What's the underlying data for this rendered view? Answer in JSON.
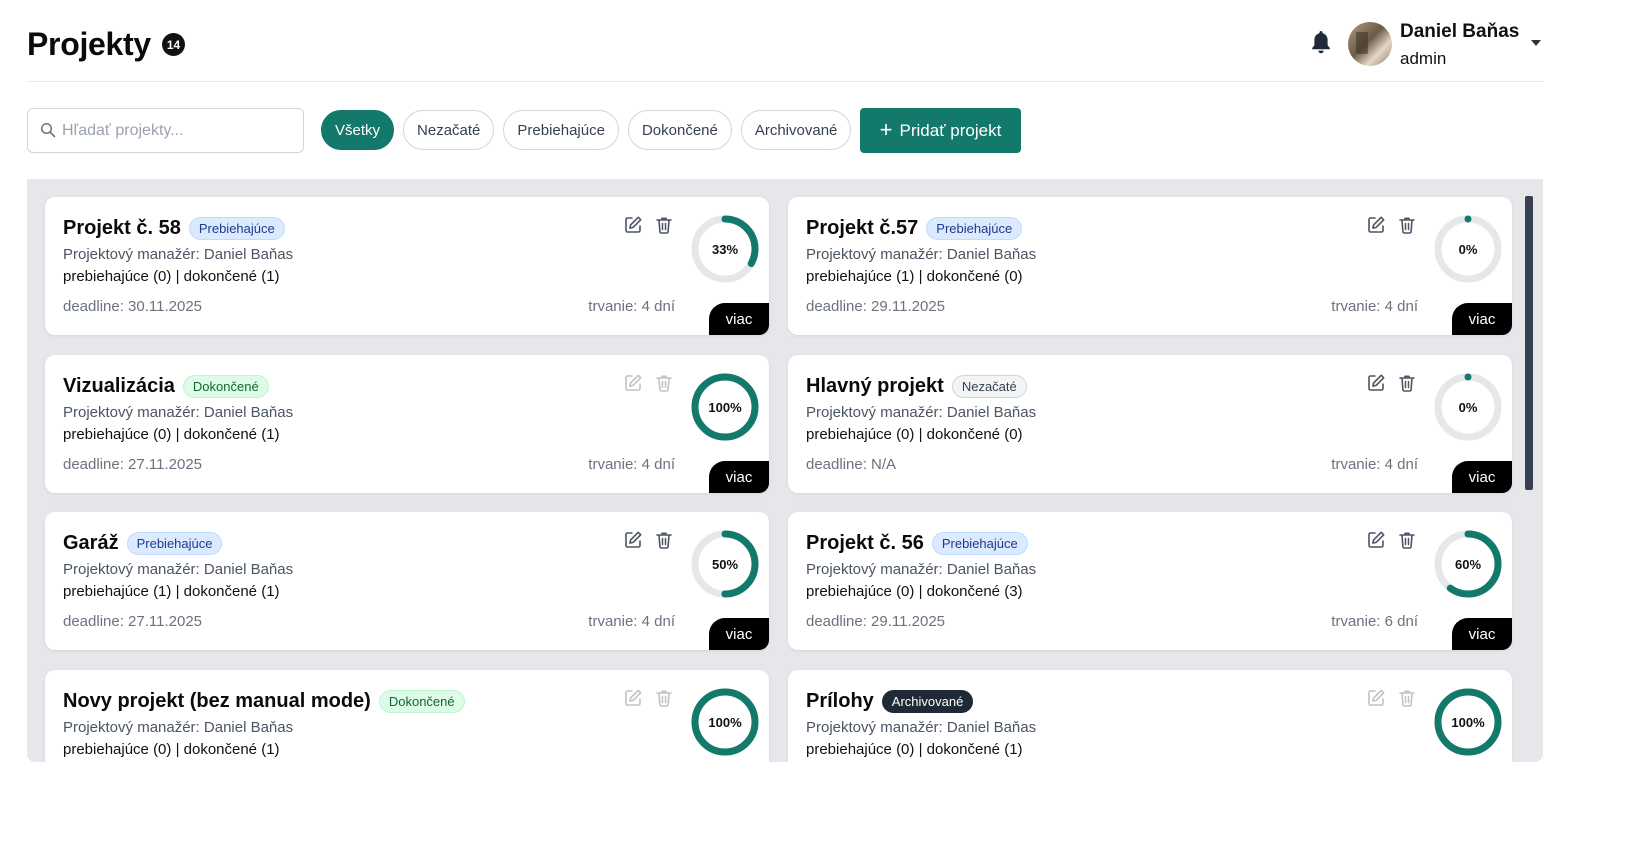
{
  "header": {
    "title": "Projekty",
    "count": "14",
    "user_name": "Daniel Baňas",
    "user_role": "admin"
  },
  "toolbar": {
    "search_placeholder": "Hľadať projekty...",
    "filters": [
      "Všetky",
      "Nezačaté",
      "Prebiehajúce",
      "Dokončené",
      "Archivované"
    ],
    "active_filter": "Všetky",
    "add_label": "Pridať projekt"
  },
  "colors": {
    "accent": "#12796b",
    "ring_track": "#e5e7eb"
  },
  "projects": [
    {
      "title": "Projekt č. 58",
      "status": "Prebiehajúce",
      "status_class": "prebiehajuce",
      "manager": "Projektový manažér: Daniel Baňas",
      "counts": "prebiehajúce (0) | dokončené (1)",
      "deadline": "deadline: 30.11.2025",
      "duration": "trvanie: 4 dní",
      "progress": 33,
      "progress_label": "33%",
      "actions_enabled": true,
      "more_label": "viac"
    },
    {
      "title": "Projekt č.57",
      "status": "Prebiehajúce",
      "status_class": "prebiehajuce",
      "manager": "Projektový manažér: Daniel Baňas",
      "counts": "prebiehajúce (1) | dokončené (0)",
      "deadline": "deadline: 29.11.2025",
      "duration": "trvanie: 4 dní",
      "progress": 0,
      "progress_label": "0%",
      "actions_enabled": true,
      "more_label": "viac"
    },
    {
      "title": "Vizualizácia",
      "status": "Dokončené",
      "status_class": "dokoncene",
      "manager": "Projektový manažér: Daniel Baňas",
      "counts": "prebiehajúce (0) | dokončené (1)",
      "deadline": "deadline: 27.11.2025",
      "duration": "trvanie: 4 dní",
      "progress": 100,
      "progress_label": "100%",
      "actions_enabled": false,
      "more_label": "viac"
    },
    {
      "title": "Hlavný projekt",
      "status": "Nezačaté",
      "status_class": "nezacate",
      "manager": "Projektový manažér: Daniel Baňas",
      "counts": "prebiehajúce (0) | dokončené (0)",
      "deadline": "deadline: N/A",
      "duration": "trvanie: 4 dní",
      "progress": 0,
      "progress_label": "0%",
      "actions_enabled": true,
      "more_label": "viac"
    },
    {
      "title": "Garáž",
      "status": "Prebiehajúce",
      "status_class": "prebiehajuce",
      "manager": "Projektový manažér: Daniel Baňas",
      "counts": "prebiehajúce (1) | dokončené (1)",
      "deadline": "deadline: 27.11.2025",
      "duration": "trvanie: 4 dní",
      "progress": 50,
      "progress_label": "50%",
      "actions_enabled": true,
      "more_label": "viac"
    },
    {
      "title": "Projekt č. 56",
      "status": "Prebiehajúce",
      "status_class": "prebiehajuce",
      "manager": "Projektový manažér: Daniel Baňas",
      "counts": "prebiehajúce (0) | dokončené (3)",
      "deadline": "deadline: 29.11.2025",
      "duration": "trvanie: 6 dní",
      "progress": 60,
      "progress_label": "60%",
      "actions_enabled": true,
      "more_label": "viac"
    },
    {
      "title": "Novy projekt (bez manual mode)",
      "status": "Dokončené",
      "status_class": "dokoncene",
      "manager": "Projektový manažér: Daniel Baňas",
      "counts": "prebiehajúce (0) | dokončené (1)",
      "deadline": "",
      "duration": "",
      "progress": 100,
      "progress_label": "100%",
      "actions_enabled": false,
      "more_label": ""
    },
    {
      "title": "Prílohy",
      "status": "Archivované",
      "status_class": "archivovane",
      "manager": "Projektový manažér: Daniel Baňas",
      "counts": "prebiehajúce (0) | dokončené (1)",
      "deadline": "",
      "duration": "",
      "progress": 100,
      "progress_label": "100%",
      "actions_enabled": false,
      "more_label": ""
    }
  ]
}
